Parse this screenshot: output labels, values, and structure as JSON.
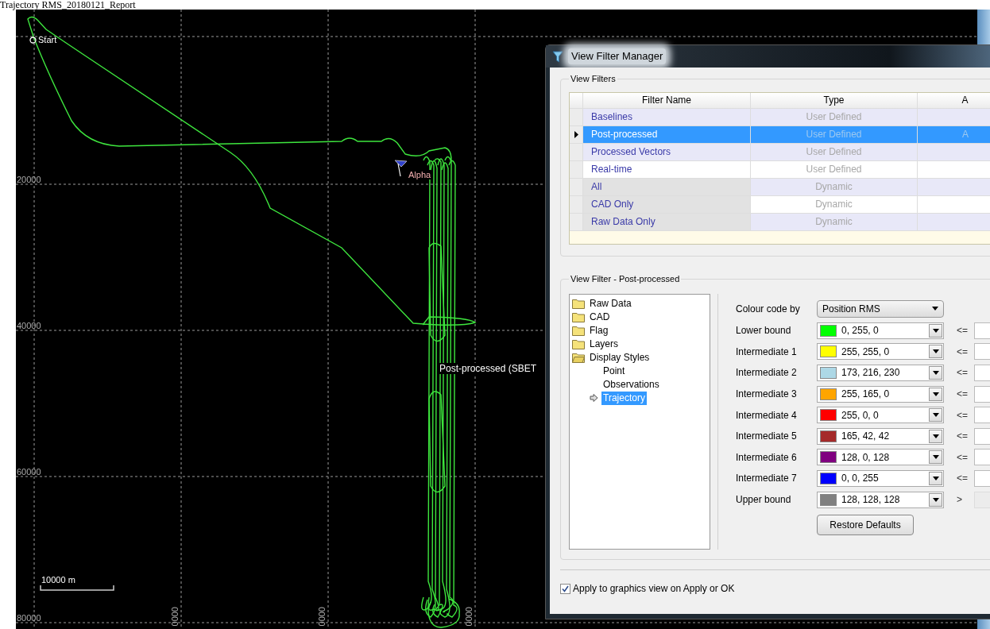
{
  "report_title": "Trajectory RMS_20180121_Report",
  "map": {
    "y_labels": [
      "20000",
      "40000",
      "60000",
      "80000"
    ],
    "x_labels": [
      "0000",
      "0000",
      "0000"
    ],
    "markers": [
      {
        "kind": "start",
        "label": "Start"
      },
      {
        "kind": "flag",
        "label": "Alpha"
      }
    ],
    "trajectory_label": "Post-processed (SBET",
    "scale_bar": "10000 m"
  },
  "dialog": {
    "title": "View Filter Manager",
    "view_filters": {
      "group_label": "View Filters",
      "columns": [
        "Filter Name",
        "Type",
        "A"
      ],
      "rows": [
        {
          "name": "Baselines",
          "type": "User Defined",
          "readonly": false,
          "selected": false
        },
        {
          "name": "Post-processed",
          "type": "User Defined",
          "column_3": "A",
          "readonly": false,
          "selected": true
        },
        {
          "name": "Processed Vectors",
          "type": "User Defined",
          "readonly": false,
          "selected": false
        },
        {
          "name": "Real-time",
          "type": "User Defined",
          "readonly": false,
          "selected": false
        },
        {
          "name": "All",
          "type": "Dynamic",
          "readonly": true,
          "selected": false
        },
        {
          "name": "CAD Only",
          "type": "Dynamic",
          "readonly": true,
          "selected": false
        },
        {
          "name": "Raw Data Only",
          "type": "Dynamic",
          "readonly": true,
          "selected": false
        }
      ]
    },
    "detail": {
      "group_label": "View Filter - Post-processed",
      "tree": [
        {
          "label": "Raw Data",
          "expanded": false,
          "selected": false
        },
        {
          "label": "CAD",
          "expanded": false,
          "selected": false
        },
        {
          "label": "Flag",
          "expanded": false,
          "selected": false
        },
        {
          "label": "Layers",
          "expanded": false,
          "selected": false
        },
        {
          "label": "Display Styles",
          "expanded": true,
          "selected": false,
          "children": [
            {
              "label": "Point",
              "selected": false
            },
            {
              "label": "Observations",
              "selected": false
            },
            {
              "label": "Trajectory",
              "selected": true
            }
          ]
        }
      ],
      "colour_code_label": "Colour code by",
      "colour_code_value": "Position RMS",
      "bounds": [
        {
          "label": "Lower bound",
          "value": "0, 255, 0",
          "color": "#00ff00",
          "operator": "<=",
          "disabled": false
        },
        {
          "label": "Intermediate 1",
          "value": "255, 255, 0",
          "color": "#ffff00",
          "operator": "<=",
          "disabled": false
        },
        {
          "label": "Intermediate 2",
          "value": "173, 216, 230",
          "color": "#add8e6",
          "operator": "<=",
          "disabled": false
        },
        {
          "label": "Intermediate 3",
          "value": "255, 165, 0",
          "color": "#ffa500",
          "operator": "<=",
          "disabled": false
        },
        {
          "label": "Intermediate 4",
          "value": "255, 0, 0",
          "color": "#ff0000",
          "operator": "<=",
          "disabled": false
        },
        {
          "label": "Intermediate 5",
          "value": "165, 42, 42",
          "color": "#a52a2a",
          "operator": "<=",
          "disabled": false
        },
        {
          "label": "Intermediate 6",
          "value": "128, 0, 128",
          "color": "#800080",
          "operator": "<=",
          "disabled": false
        },
        {
          "label": "Intermediate 7",
          "value": "0, 0, 255",
          "color": "#0000ff",
          "operator": "<=",
          "disabled": false
        },
        {
          "label": "Upper bound",
          "value": "128, 128, 128",
          "color": "#808080",
          "operator": ">",
          "disabled": true
        }
      ],
      "restore_button": "Restore Defaults"
    },
    "apply_checkbox": {
      "label": "Apply to graphics view on Apply or OK",
      "checked": true
    }
  }
}
